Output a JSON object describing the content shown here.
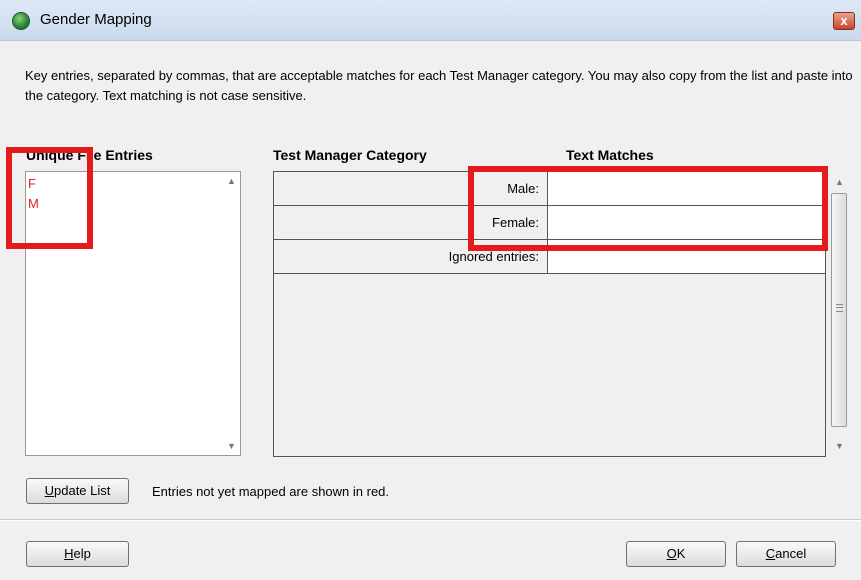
{
  "window": {
    "title": "Gender Mapping",
    "close_label": "x"
  },
  "description": "Key entries, separated by commas, that are acceptable matches for each Test Manager category.  You may also copy from the list and paste into the category.  Text matching is not case sensitive.",
  "unique_entries": {
    "header": "Unique File Entries",
    "items": [
      "F",
      "M"
    ]
  },
  "mapping": {
    "category_header": "Test Manager Category",
    "matches_header": "Text Matches",
    "rows": [
      {
        "label": "Male:",
        "value": ""
      },
      {
        "label": "Female:",
        "value": ""
      },
      {
        "label": "Ignored entries:",
        "value": ""
      }
    ]
  },
  "update_button": {
    "mnemonic": "U",
    "rest": "pdate List"
  },
  "note": "Entries not yet mapped are shown in red.",
  "help_button": {
    "mnemonic": "H",
    "rest": "elp"
  },
  "ok_button": {
    "mnemonic": "O",
    "rest": "K"
  },
  "cancel_button": {
    "mnemonic": "C",
    "rest": "ancel"
  },
  "colors": {
    "unmapped_entry": "#e02020",
    "highlight": "#e21b1b"
  }
}
